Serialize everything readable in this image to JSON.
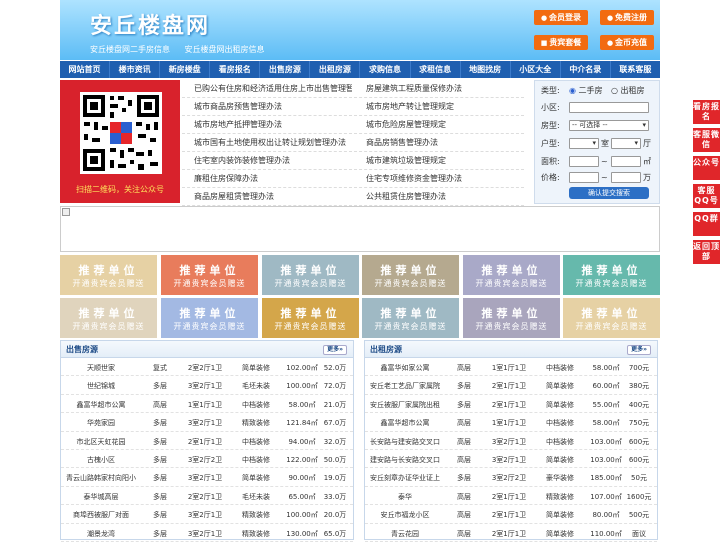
{
  "header": {
    "logo": "安丘楼盘网",
    "sub_links": [
      "安丘楼盘网二手房信息",
      "安丘楼盘网出租房信息"
    ],
    "buttons": [
      "会员登录",
      "免费注册",
      "贵宾套餐",
      "金币充值"
    ]
  },
  "nav": [
    "网站首页",
    "楼市资讯",
    "新房楼盘",
    "看房报名",
    "出售房源",
    "出租房源",
    "求购信息",
    "求租信息",
    "地图找房",
    "小区大全",
    "中介名录",
    "联系客服"
  ],
  "qr": {
    "caption": "扫描二维码，关注公众号"
  },
  "news_left": [
    "已购公有住房和经济适用住房上市出售管理暂",
    "城市商品房预售管理办法",
    "城市房地产抵押管理办法",
    "城市国有土地使用权出让转让规划管理办法",
    "住宅室内装饰装修管理办法",
    "廉租住房保障办法",
    "商品房屋租赁管理办法"
  ],
  "news_right": [
    "房屋建筑工程质量保修办法",
    "城市房地产转让管理规定",
    "城市危险房屋管理规定",
    "商品房销售管理办法",
    "城市建筑垃圾管理规定",
    "住宅专项维修资金管理办法",
    "公共租赁住房管理办法"
  ],
  "search": {
    "labels": [
      "类型:",
      "小区:",
      "房型:",
      "户型:",
      "面积:",
      "价格:"
    ],
    "radio_sale": "二手房",
    "radio_rent": "出租房",
    "select_placeholder": "-- 可选择 --",
    "room_unit": "室",
    "hall_unit": "厅",
    "area_unit": "㎡",
    "price_unit": "万",
    "tilde": "~",
    "submit": "确认提交搜索"
  },
  "promo": {
    "title": "推荐单位",
    "subtitle": "开通贵宾会员赠送"
  },
  "promo_colors": [
    "#e6d1a4",
    "#e87c5c",
    "#9fb9c4",
    "#b5a98f",
    "#a9a9c8",
    "#66b9ac",
    "#e0d4bd",
    "#a3b9e3",
    "#d4a64a",
    "#9fb9c4",
    "#a9a5bd",
    "#e6d1a4"
  ],
  "sale": {
    "title": "出售房源",
    "more": "更多»",
    "rows": [
      [
        "天顺世家",
        "复式",
        "2室2厅1卫",
        "简单装修",
        "102.00㎡",
        "52.0万"
      ],
      [
        "世纪锦城",
        "多层",
        "3室2厅1卫",
        "毛坯未装",
        "100.00㎡",
        "72.0万"
      ],
      [
        "鑫富华超市公寓",
        "高层",
        "1室1厅1卫",
        "中档装修",
        "58.00㎡",
        "21.0万"
      ],
      [
        "华苑家园",
        "多层",
        "3室2厅1卫",
        "精致装修",
        "121.84㎡",
        "67.0万"
      ],
      [
        "市北区天虹花园",
        "多层",
        "2室1厅1卫",
        "中档装修",
        "94.00㎡",
        "32.0万"
      ],
      [
        "古槐小区",
        "多层",
        "3室2厅2卫",
        "中档装修",
        "122.00㎡",
        "50.0万"
      ],
      [
        "青云山路韩家村向阳小",
        "多层",
        "3室2厅1卫",
        "简单装修",
        "90.00㎡",
        "19.0万"
      ],
      [
        "泰华城高层",
        "多层",
        "2室2厅1卫",
        "毛坯未装",
        "65.00㎡",
        "33.0万"
      ],
      [
        "商埠西被服厂对面",
        "多层",
        "3室2厅1卫",
        "精致装修",
        "100.00㎡",
        "20.0万"
      ],
      [
        "潮景龙湾",
        "多层",
        "3室2厅1卫",
        "精致装修",
        "130.00㎡",
        "65.0万"
      ]
    ]
  },
  "rent": {
    "title": "出租房源",
    "more": "更多»",
    "rows": [
      [
        "鑫富华如家公寓",
        "高层",
        "1室1厅1卫",
        "中档装修",
        "58.00㎡",
        "700元"
      ],
      [
        "安丘老工艺品厂家属院",
        "多层",
        "2室1厅1卫",
        "简单装修",
        "60.00㎡",
        "380元"
      ],
      [
        "安丘被服厂家属院出租",
        "多层",
        "2室1厅1卫",
        "简单装修",
        "55.00㎡",
        "400元"
      ],
      [
        "鑫富华超市公寓",
        "高层",
        "1室1厅1卫",
        "中档装修",
        "58.00㎡",
        "750元"
      ],
      [
        "长安路与建安路交叉口",
        "高层",
        "3室2厅1卫",
        "中档装修",
        "103.00㎡",
        "600元"
      ],
      [
        "建安路与长安路交叉口",
        "高层",
        "3室2厅1卫",
        "简单装修",
        "103.00㎡",
        "600元"
      ],
      [
        "安丘刻章办证华业证上",
        "多层",
        "3室2厅2卫",
        "豪华装修",
        "185.00㎡",
        "50元"
      ],
      [
        "泰华",
        "高层",
        "2室1厅1卫",
        "精致装修",
        "107.00㎡",
        "1600元"
      ],
      [
        "安丘市福龙小区",
        "高层",
        "2室1厅1卫",
        "简单装修",
        "80.00㎡",
        "500元"
      ],
      [
        "青云花园",
        "高层",
        "2室1厅1卫",
        "简单装修",
        "110.00㎡",
        "面议"
      ]
    ]
  },
  "side": [
    "看房报名",
    "客服微信",
    "公众号",
    "客服QQ号",
    "QQ群",
    "返回顶部"
  ]
}
